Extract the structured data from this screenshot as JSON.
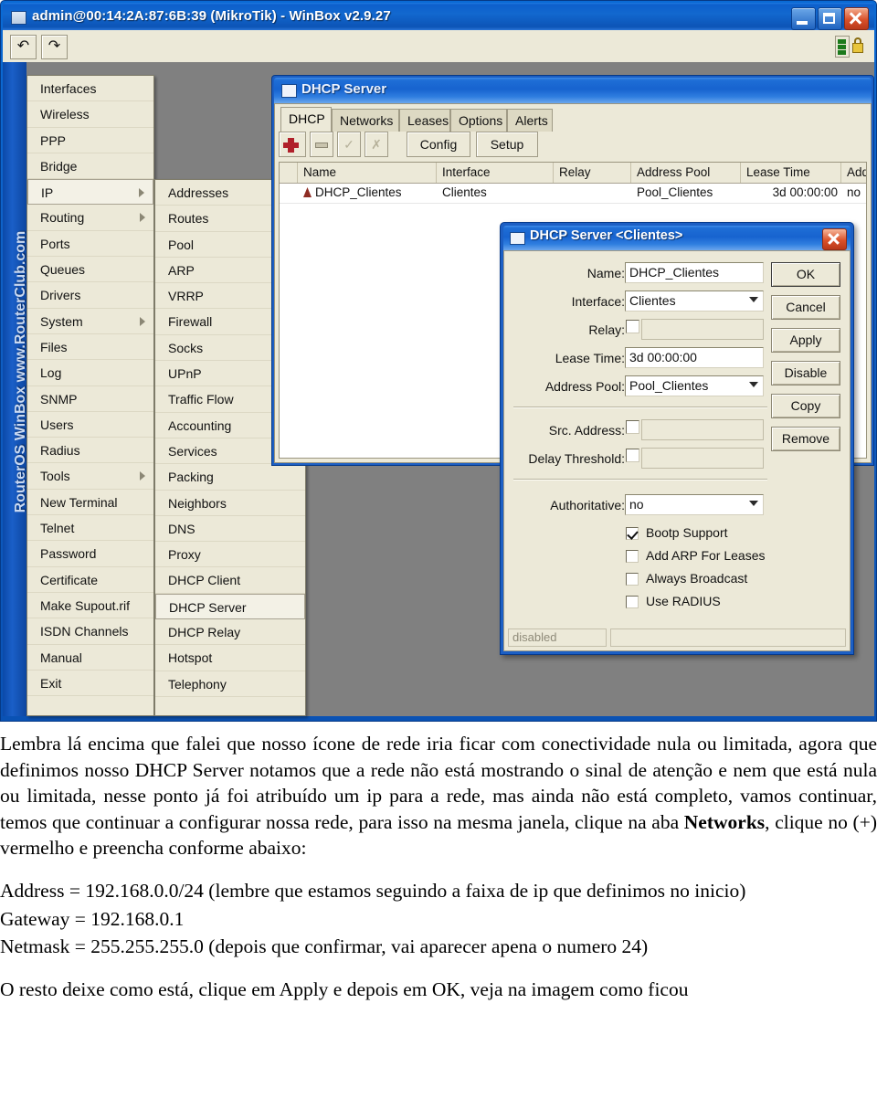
{
  "window": {
    "title": "admin@00:14:2A:87:6B:39 (MikroTik) - WinBox v2.9.27",
    "minimize_label": "Minimize",
    "maximize_label": "Maximize",
    "close_label": "Close",
    "toolbar": {
      "back_label": "↰",
      "forward_label": "↱"
    },
    "watermark": "RouterOS WinBox  www.RouterClub.com"
  },
  "menu_main": {
    "items": [
      {
        "label": "Interfaces",
        "submenu": false,
        "selected": false
      },
      {
        "label": "Wireless",
        "submenu": false,
        "selected": false
      },
      {
        "label": "PPP",
        "submenu": false,
        "selected": false
      },
      {
        "label": "Bridge",
        "submenu": false,
        "selected": false
      },
      {
        "label": "IP",
        "submenu": true,
        "selected": true
      },
      {
        "label": "Routing",
        "submenu": true,
        "selected": false
      },
      {
        "label": "Ports",
        "submenu": false,
        "selected": false
      },
      {
        "label": "Queues",
        "submenu": false,
        "selected": false
      },
      {
        "label": "Drivers",
        "submenu": false,
        "selected": false
      },
      {
        "label": "System",
        "submenu": true,
        "selected": false
      },
      {
        "label": "Files",
        "submenu": false,
        "selected": false
      },
      {
        "label": "Log",
        "submenu": false,
        "selected": false
      },
      {
        "label": "SNMP",
        "submenu": false,
        "selected": false
      },
      {
        "label": "Users",
        "submenu": false,
        "selected": false
      },
      {
        "label": "Radius",
        "submenu": false,
        "selected": false
      },
      {
        "label": "Tools",
        "submenu": true,
        "selected": false
      },
      {
        "label": "New Terminal",
        "submenu": false,
        "selected": false
      },
      {
        "label": "Telnet",
        "submenu": false,
        "selected": false
      },
      {
        "label": "Password",
        "submenu": false,
        "selected": false
      },
      {
        "label": "Certificate",
        "submenu": false,
        "selected": false
      },
      {
        "label": "Make Supout.rif",
        "submenu": false,
        "selected": false
      },
      {
        "label": "ISDN Channels",
        "submenu": false,
        "selected": false
      },
      {
        "label": "Manual",
        "submenu": false,
        "selected": false
      },
      {
        "label": "Exit",
        "submenu": false,
        "selected": false
      }
    ]
  },
  "menu_ip": {
    "items": [
      {
        "label": "Addresses",
        "selected": false
      },
      {
        "label": "Routes",
        "selected": false
      },
      {
        "label": "Pool",
        "selected": false
      },
      {
        "label": "ARP",
        "selected": false
      },
      {
        "label": "VRRP",
        "selected": false
      },
      {
        "label": "Firewall",
        "selected": false
      },
      {
        "label": "Socks",
        "selected": false
      },
      {
        "label": "UPnP",
        "selected": false
      },
      {
        "label": "Traffic Flow",
        "selected": false
      },
      {
        "label": "Accounting",
        "selected": false
      },
      {
        "label": "Services",
        "selected": false
      },
      {
        "label": "Packing",
        "selected": false
      },
      {
        "label": "Neighbors",
        "selected": false
      },
      {
        "label": "DNS",
        "selected": false
      },
      {
        "label": "Proxy",
        "selected": false
      },
      {
        "label": "DHCP Client",
        "selected": false
      },
      {
        "label": "DHCP Server",
        "selected": true
      },
      {
        "label": "DHCP Relay",
        "selected": false
      },
      {
        "label": "Hotspot",
        "selected": false
      },
      {
        "label": "Telephony",
        "selected": false
      }
    ]
  },
  "dhcp_window": {
    "title": "DHCP Server",
    "tabs": [
      {
        "label": "DHCP",
        "active": true
      },
      {
        "label": "Networks",
        "active": false
      },
      {
        "label": "Leases",
        "active": false
      },
      {
        "label": "Options",
        "active": false
      },
      {
        "label": "Alerts",
        "active": false
      }
    ],
    "toolbar": {
      "add_label": "+",
      "remove_label": "-",
      "enable_label": "✓",
      "disable_label": "✗",
      "config_label": "Config",
      "setup_label": "Setup"
    },
    "table": {
      "columns": [
        "Name",
        "Interface",
        "Relay",
        "Address Pool",
        "Lease Time",
        "Add."
      ],
      "rows": [
        {
          "name": "DHCP_Clientes",
          "interface": "Clientes",
          "relay": "",
          "address_pool": "Pool_Clientes",
          "lease_time": "3d 00:00:00",
          "add": "no"
        }
      ]
    }
  },
  "dialog": {
    "title": "DHCP Server <Clientes>",
    "fields": {
      "name_label": "Name:",
      "name_value": "DHCP_Clientes",
      "interface_label": "Interface:",
      "interface_value": "Clientes",
      "relay_label": "Relay:",
      "relay_value": "",
      "lease_time_label": "Lease Time:",
      "lease_time_value": "3d 00:00:00",
      "address_pool_label": "Address Pool:",
      "address_pool_value": "Pool_Clientes",
      "src_address_label": "Src. Address:",
      "src_address_value": "",
      "delay_threshold_label": "Delay Threshold:",
      "delay_threshold_value": "",
      "authoritative_label": "Authoritative:",
      "authoritative_value": "no"
    },
    "checkboxes": [
      {
        "label": "Bootp Support",
        "checked": true
      },
      {
        "label": "Add ARP For Leases",
        "checked": false
      },
      {
        "label": "Always Broadcast",
        "checked": false
      },
      {
        "label": "Use RADIUS",
        "checked": false
      }
    ],
    "buttons": [
      {
        "label": "OK",
        "primary": true
      },
      {
        "label": "Cancel",
        "primary": false
      },
      {
        "label": "Apply",
        "primary": false
      },
      {
        "label": "Disable",
        "primary": false
      },
      {
        "label": "Copy",
        "primary": false
      },
      {
        "label": "Remove",
        "primary": false
      }
    ],
    "status": "disabled"
  },
  "prose": {
    "p1": "Lembra lá encima que falei que nosso ícone de rede iria ficar com conectividade nula ou limitada, agora que definimos nosso DHCP Server notamos que a rede não está mostrando o sinal de atenção e nem que está nula ou limitada, nesse ponto já foi atribuído um ip para a rede, mas ainda não está completo, vamos continuar, temos que continuar a configurar nossa rede, para isso na mesma janela, clique na aba ",
    "p1_bold": "Networks",
    "p1_tail": ", clique no (+) vermelho e  preencha conforme abaixo:",
    "p2": "Address = 192.168.0.0/24  (lembre que estamos seguindo a faixa de ip que definimos no inicio)",
    "p3": "Gateway = 192.168.0.1",
    "p4": "Netmask = 255.255.255.0 (depois que confirmar, vai aparecer apena o numero 24)",
    "p5": "O resto deixe como está, clique em Apply e depois em OK, veja na imagem como ficou"
  }
}
